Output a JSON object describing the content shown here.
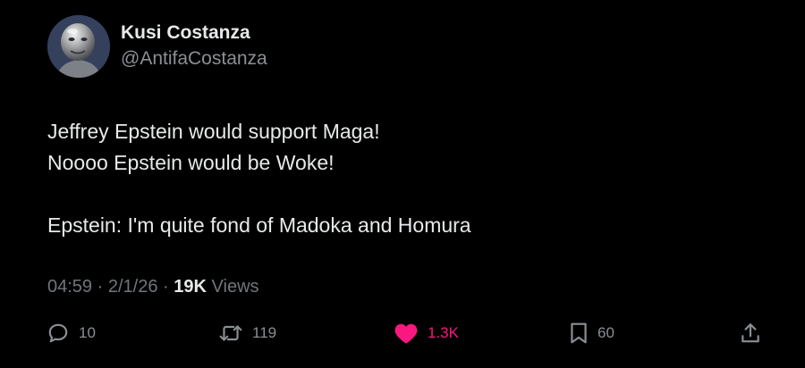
{
  "author": {
    "display_name": "Kusi Costanza",
    "handle": "@AntifaCostanza",
    "avatar_icon": "avatar-metallic-face"
  },
  "post": {
    "lines": [
      "Jeffrey Epstein would support Maga!",
      "Noooo Epstein would be Woke!",
      "",
      "Epstein: I'm quite fond of Madoka and Homura"
    ]
  },
  "meta": {
    "time": "04:59",
    "separator": "·",
    "date": "2/1/26",
    "views_count": "19K",
    "views_label": "Views"
  },
  "actions": {
    "reply": {
      "icon": "reply-icon",
      "count": "10"
    },
    "repost": {
      "icon": "repost-icon",
      "count": "119"
    },
    "like": {
      "icon": "heart-icon",
      "count": "1.3K",
      "liked": true
    },
    "bookmark": {
      "icon": "bookmark-icon",
      "count": "60"
    },
    "share": {
      "icon": "share-icon"
    }
  },
  "colors": {
    "background": "#000000",
    "primary_text": "#e7e9ea",
    "secondary_text": "#71767b",
    "like_accent": "#f91880"
  }
}
